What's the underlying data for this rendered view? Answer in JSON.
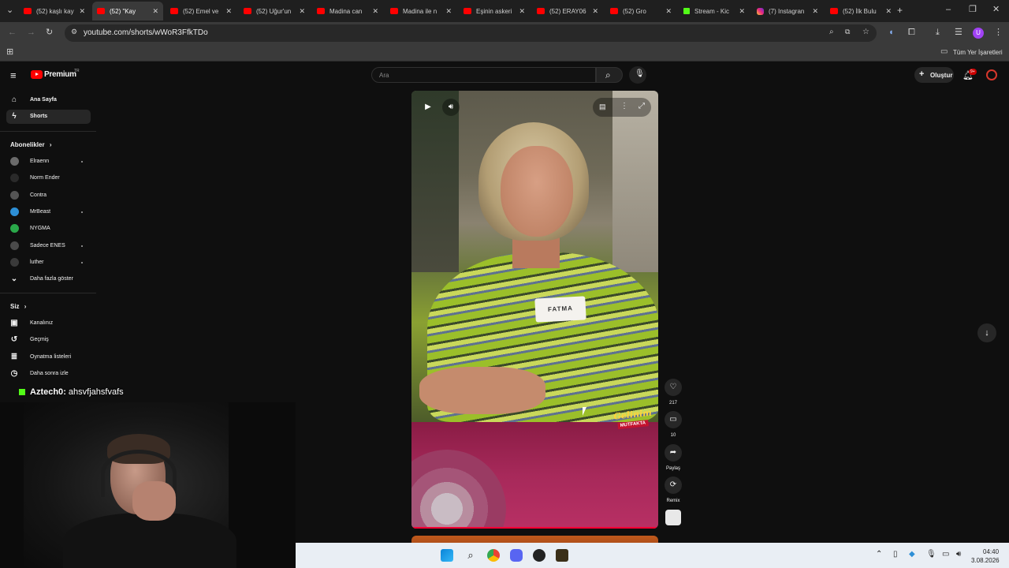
{
  "browser": {
    "tabs": [
      {
        "title": "(52) kaşlı kay",
        "icon": "youtube-icon",
        "active": false
      },
      {
        "title": "(52) \"Kay",
        "icon": "youtube-icon",
        "active": true
      },
      {
        "title": "(52) Emel ve",
        "icon": "youtube-icon",
        "active": false
      },
      {
        "title": "(52) Uğur'un",
        "icon": "youtube-icon",
        "active": false
      },
      {
        "title": "Madina can",
        "icon": "youtube-icon",
        "active": false
      },
      {
        "title": "Madina ile n",
        "icon": "youtube-icon",
        "active": false
      },
      {
        "title": "Eşinin askeri",
        "icon": "youtube-icon",
        "active": false
      },
      {
        "title": "(52) ERAY06",
        "icon": "youtube-icon",
        "active": false
      },
      {
        "title": "(52) Gro",
        "icon": "youtube-icon",
        "active": false
      },
      {
        "title": "Stream - Kic",
        "icon": "kick-icon",
        "active": false
      },
      {
        "title": "(7) Instagran",
        "icon": "instagram-icon",
        "active": false
      },
      {
        "title": "(52) İlk Bulu",
        "icon": "youtube-icon",
        "active": false
      }
    ],
    "url": "youtube.com/shorts/wWoR3FfkTDo",
    "bookmarks_label": "Tüm Yer İşaretleri",
    "profile_initial": "U"
  },
  "youtube": {
    "logo_text": "Premium",
    "logo_region": "TR",
    "search_placeholder": "Ara",
    "create_label": "Oluştur",
    "notification_count": "9+",
    "sidebar": {
      "main": [
        {
          "label": "Ana Sayfa",
          "icon": "home-icon",
          "active": false
        },
        {
          "label": "Shorts",
          "icon": "shorts-icon",
          "active": true
        }
      ],
      "subscriptions_heading": "Abonelikler",
      "subscriptions": [
        {
          "label": "Elraenn",
          "color": "#6b6b6b",
          "dot": true
        },
        {
          "label": "Norm Ender",
          "color": "#2a2a2a",
          "dot": false
        },
        {
          "label": "Contra",
          "color": "#555555",
          "dot": false
        },
        {
          "label": "MrBeast",
          "color": "#2d8fd6",
          "dot": true
        },
        {
          "label": "NYGMA",
          "color": "#2aa84a",
          "dot": false
        },
        {
          "label": "Sadece ENES",
          "color": "#4a4a4a",
          "dot": true
        },
        {
          "label": "luther",
          "color": "#3a3a3a",
          "dot": true
        }
      ],
      "show_more_label": "Daha fazla göster",
      "you_heading": "Siz",
      "you_items": [
        {
          "label": "Kanalınız",
          "icon": "channel-icon"
        },
        {
          "label": "Geçmiş",
          "icon": "history-icon"
        },
        {
          "label": "Oynatma listeleri",
          "icon": "playlist-icon"
        },
        {
          "label": "Daha sonra izle",
          "icon": "watch-later-icon"
        }
      ]
    },
    "short": {
      "name_tag": "FATMA",
      "brand_line1": "Gelinim",
      "brand_line2": "MUTFAKTA"
    },
    "actions": [
      {
        "name": "like",
        "icon": "heart-icon",
        "label": "217"
      },
      {
        "name": "comment",
        "icon": "comment-icon",
        "label": "10"
      },
      {
        "name": "share",
        "icon": "share-icon",
        "label": "Paylaş"
      },
      {
        "name": "remix",
        "icon": "remix-icon",
        "label": "Remix"
      }
    ]
  },
  "overlay": {
    "chat_user": "Aztech0",
    "chat_message": "ahsvfjahsfvafs"
  },
  "taskbar": {
    "time": "04:40",
    "date": "3.08.2026"
  }
}
